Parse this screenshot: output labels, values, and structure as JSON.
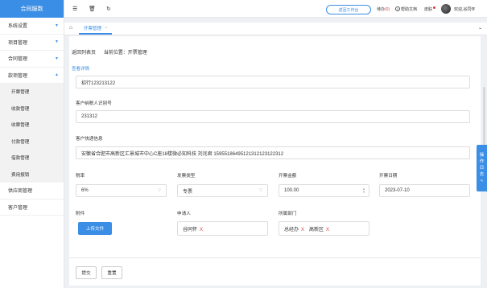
{
  "sidebar": {
    "app_title": "合同服数",
    "items": [
      {
        "label": "系统设置"
      },
      {
        "label": "项目管理"
      },
      {
        "label": "合同管理"
      },
      {
        "label": "款项管理"
      },
      {
        "label": "供应商管理"
      },
      {
        "label": "客户管理"
      }
    ],
    "subitems": [
      {
        "label": "开票管理"
      },
      {
        "label": "收款管理"
      },
      {
        "label": "收票管理"
      },
      {
        "label": "付款管理"
      },
      {
        "label": "借款管理"
      },
      {
        "label": "费用报销"
      }
    ]
  },
  "topbar": {
    "menu_icon": "hamburger-icon",
    "workspace_button": "返回工作台",
    "todo_label": "待办",
    "todo_count": "(0)",
    "help_label": "帮助文档",
    "skin_label": "皮肤",
    "welcome": "欢迎,谷同怀"
  },
  "tabs": {
    "active": "开票管理",
    "close": "×"
  },
  "breadcrumb": {
    "back": "返回列表页",
    "current_label": "当前位置：",
    "current": "开票管理"
  },
  "view_details": "查看详情",
  "form": {
    "bank_account_value": "招行123213122",
    "taxpayer_label": "客户纳税人识别号",
    "taxpayer_value": "231312",
    "delivery_label": "客户快递信息",
    "delivery_value": "安徽省合肥市高新区汇景城市中心C座18楼微必知科技 刘兆君 15955186495121312123122312",
    "tax_rate_label": "税率",
    "tax_rate_value": "6%",
    "invoice_type_label": "发票类型",
    "invoice_type_value": "专票",
    "amount_label": "开票金额",
    "amount_value": "100.00",
    "date_label": "开票日期",
    "date_value": "2023-07-10",
    "attachment_label": "附件",
    "upload_button": "上传文件",
    "applicant_label": "申请人",
    "applicant_tag": "谷同怀",
    "department_label": "所属部门",
    "department_tags": [
      "总经办",
      "高新区"
    ],
    "tag_remove": "X"
  },
  "actions": {
    "submit": "提交",
    "reset": "重置"
  },
  "side_tab": [
    "操",
    "作",
    "日",
    "志",
    "<"
  ],
  "colors": {
    "accent": "#3a8ee6",
    "danger": "#e4393c"
  }
}
